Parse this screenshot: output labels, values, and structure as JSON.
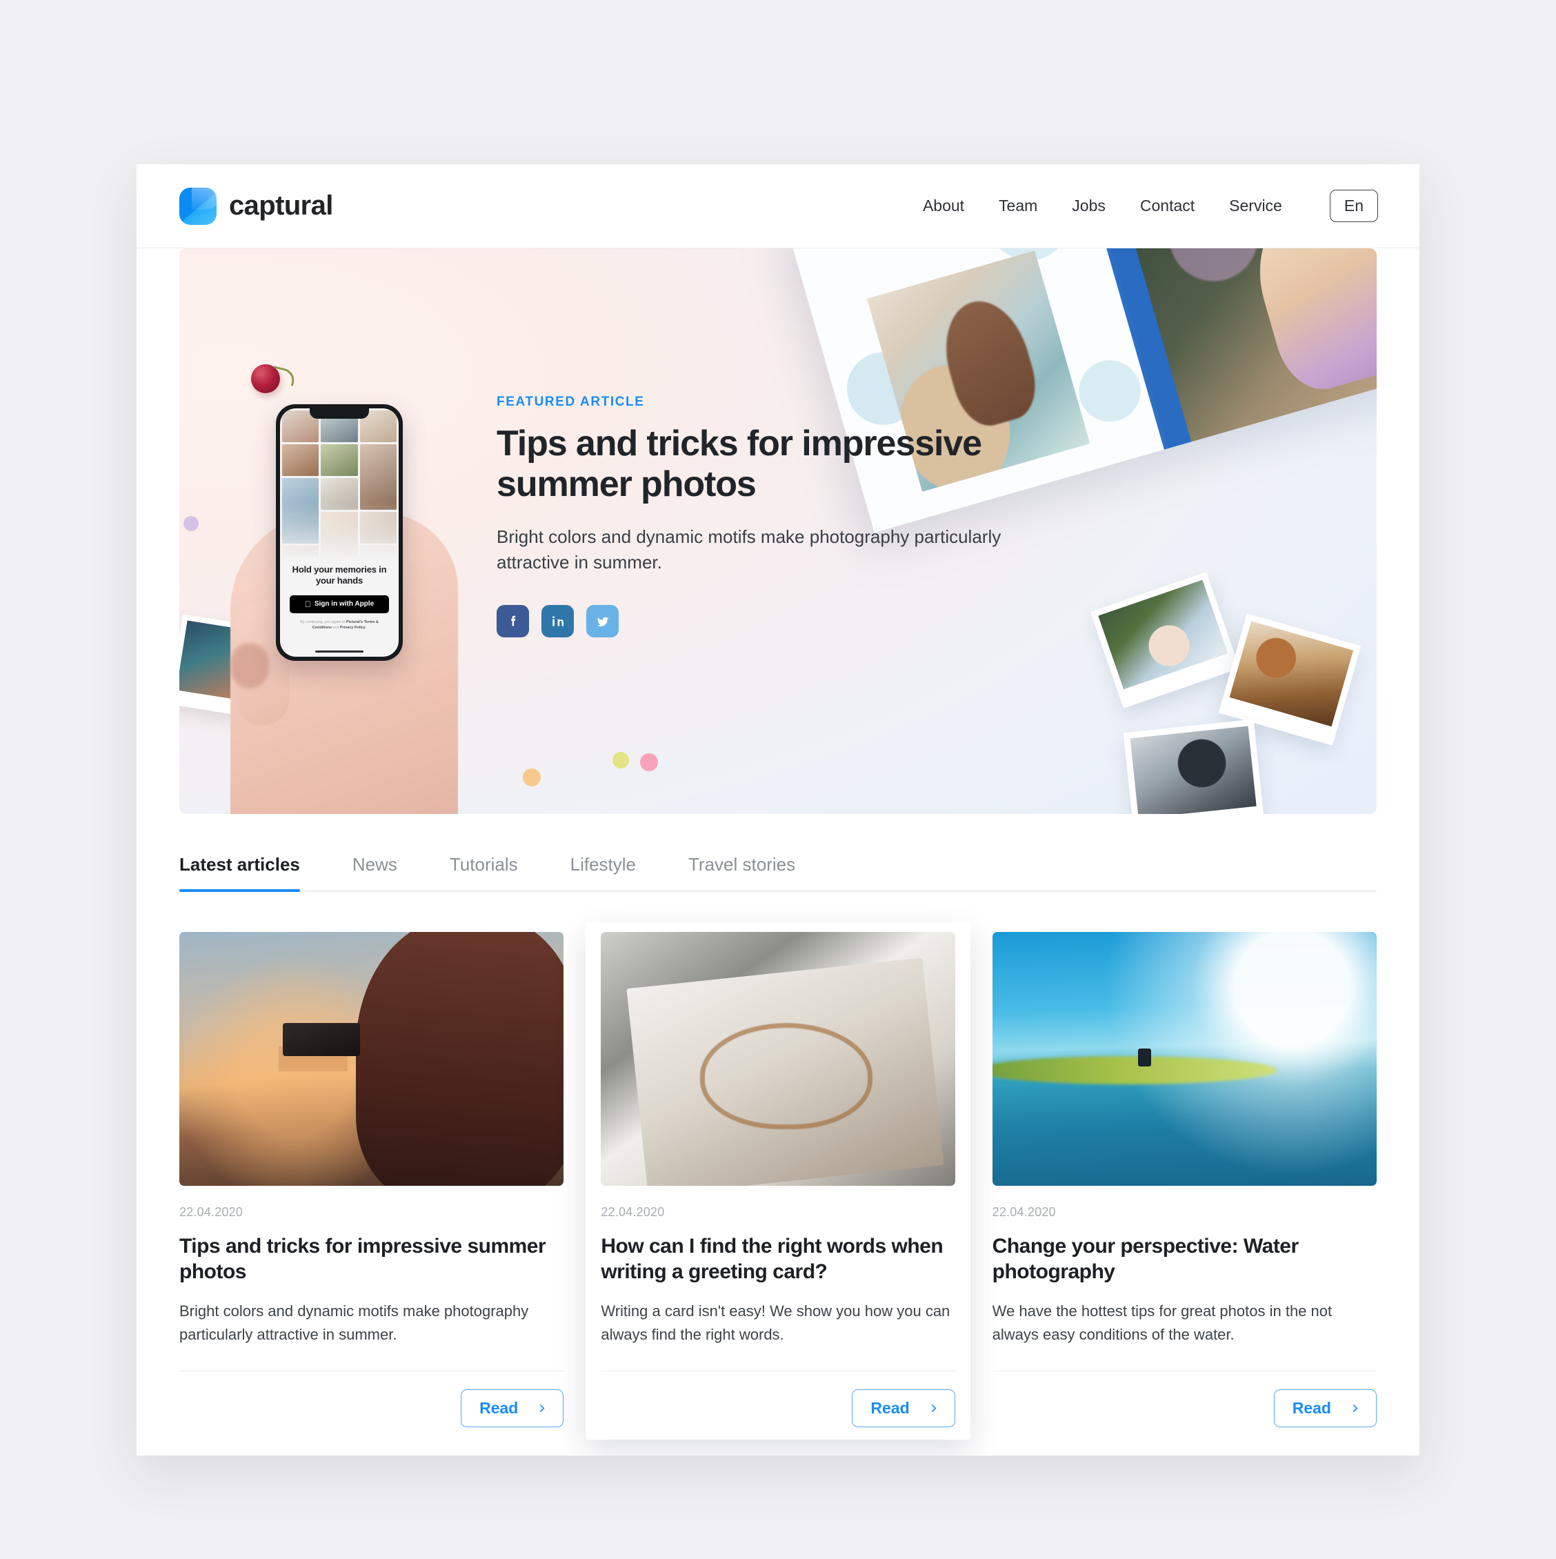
{
  "brand": {
    "name": "captural",
    "logo_icon": "captural-logo-icon",
    "accent": "#0b8bf5"
  },
  "nav": {
    "items": [
      {
        "label": "About"
      },
      {
        "label": "Team"
      },
      {
        "label": "Jobs"
      },
      {
        "label": "Contact"
      },
      {
        "label": "Service"
      }
    ],
    "language": "En"
  },
  "hero": {
    "eyebrow": "FEATURED ARTICLE",
    "title": "Tips and tricks for impressive summer photos",
    "subtitle": "Bright colors and dynamic motifs make photography particularly attractive in summer.",
    "social": [
      {
        "name": "facebook",
        "label": "Facebook",
        "color": "#3b5a96"
      },
      {
        "name": "linkedin",
        "label": "LinkedIn",
        "color": "#2f77a9"
      },
      {
        "name": "twitter",
        "label": "Twitter",
        "color": "#68b2e8"
      }
    ],
    "phone": {
      "headline": "Hold your memories in your hands",
      "signin_button": "Sign in with Apple",
      "fine_print_lead": "By continuing, you agree to ",
      "fine_print_terms": "Pictural's Terms & Conditions",
      "fine_print_mid": " and ",
      "fine_print_privacy": "Privacy Policy",
      "fine_print_end": "."
    }
  },
  "tabs": [
    {
      "label": "Latest articles",
      "active": true
    },
    {
      "label": "News",
      "active": false
    },
    {
      "label": "Tutorials",
      "active": false
    },
    {
      "label": "Lifestyle",
      "active": false
    },
    {
      "label": "Travel stories",
      "active": false
    }
  ],
  "cards": [
    {
      "date": "22.04.2020",
      "title": "Tips and tricks for impressive summer photos",
      "text": "Bright colors and dynamic motifs make photography particularly attractive in summer.",
      "read_label": "Read",
      "image_alt": "woman-photographing-sunset"
    },
    {
      "date": "22.04.2020",
      "title": "How can I find the right words when writing a greeting card?",
      "text": "Writing a card isn't easy! We show you how you can always find the right words.",
      "read_label": "Read",
      "image_alt": "greeting-card-on-envelope"
    },
    {
      "date": "22.04.2020",
      "title": "Change your perspective: Water photography",
      "text": "We have the hottest tips for great photos in the not always easy conditions of the water.",
      "read_label": "Read",
      "image_alt": "surfer-riding-wave"
    }
  ]
}
